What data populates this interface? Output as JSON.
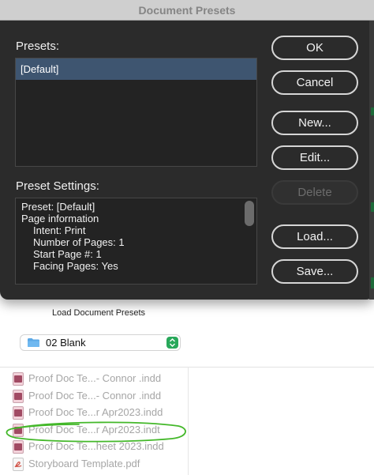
{
  "dialog": {
    "title": "Document Presets",
    "presets_label": "Presets:",
    "presets": [
      "[Default]"
    ],
    "settings_label": "Preset Settings:",
    "settings_lines": [
      "Preset: [Default]",
      "Page information",
      "Intent: Print",
      "Number of Pages: 1",
      "Start Page #: 1",
      "Facing Pages: Yes"
    ],
    "buttons": {
      "ok": "OK",
      "cancel": "Cancel",
      "new": "New...",
      "edit": "Edit...",
      "delete": "Delete",
      "load": "Load...",
      "save": "Save..."
    },
    "colors": {
      "background": "#2b2b2b",
      "selection": "#3e5570"
    }
  },
  "finder": {
    "title": "Load Document Presets",
    "location": "02 Blank",
    "files": [
      {
        "name": "Proof Doc Te...- Connor .indd",
        "icon": "indesign-file-icon"
      },
      {
        "name": "Proof Doc Te...- Connor .indd",
        "icon": "indesign-file-icon"
      },
      {
        "name": "Proof Doc Te...r Apr2023.indd",
        "icon": "indesign-file-icon"
      },
      {
        "name": "Proof Doc Te...r Apr2023.indt",
        "icon": "indesign-file-icon"
      },
      {
        "name": "Proof Doc Te...heet 2023.indd",
        "icon": "indesign-file-icon"
      },
      {
        "name": "Storyboard Template.pdf",
        "icon": "pdf-file-icon"
      }
    ],
    "colors": {
      "stepper": "#28a85a",
      "annotation": "#44b82a"
    }
  }
}
